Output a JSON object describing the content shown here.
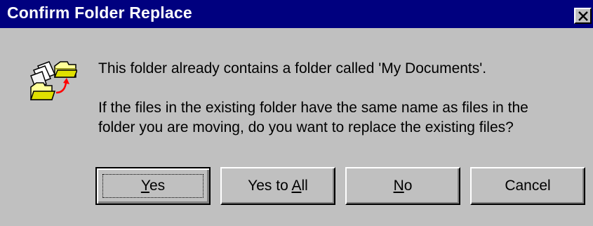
{
  "window": {
    "title": "Confirm Folder Replace",
    "close_icon": "close-icon",
    "title_bar_color": "#00007f",
    "background_color": "#c0c0c0"
  },
  "message": {
    "icon": "folder-replace-icon",
    "line1": "This folder already contains a folder called 'My Documents'.",
    "line2": "If the files in the existing folder have the same name as files in the folder you are moving, do you want to replace the existing files?"
  },
  "buttons": {
    "yes": {
      "pre": "",
      "mnemonic": "Y",
      "post": "es"
    },
    "yes_to_all": {
      "pre": "Yes to ",
      "mnemonic": "A",
      "post": "ll"
    },
    "no": {
      "pre": "",
      "mnemonic": "N",
      "post": "o"
    },
    "cancel": {
      "label": "Cancel"
    }
  }
}
